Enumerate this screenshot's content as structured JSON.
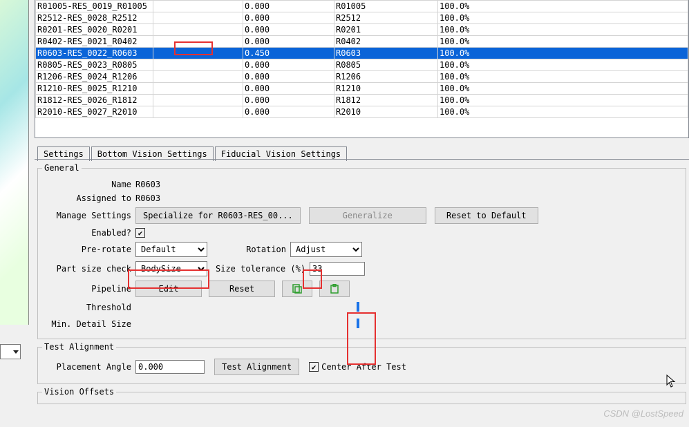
{
  "table": {
    "rows": [
      {
        "c1": "R01005-RES_0019_R01005",
        "c3": "0.000",
        "c4": "R01005",
        "c5": "100.0%"
      },
      {
        "c1": "R2512-RES_0028_R2512",
        "c3": "0.000",
        "c4": "R2512",
        "c5": "100.0%"
      },
      {
        "c1": "R0201-RES_0020_R0201",
        "c3": "0.000",
        "c4": "R0201",
        "c5": "100.0%"
      },
      {
        "c1": "R0402-RES_0021_R0402",
        "c3": "0.000",
        "c4": "R0402",
        "c5": "100.0%"
      },
      {
        "c1": "R0603-RES_0022_R0603",
        "c3": "0.450",
        "c4": "R0603",
        "c5": "100.0%",
        "sel": true
      },
      {
        "c1": "R0805-RES_0023_R0805",
        "c3": "0.000",
        "c4": "R0805",
        "c5": "100.0%"
      },
      {
        "c1": "R1206-RES_0024_R1206",
        "c3": "0.000",
        "c4": "R1206",
        "c5": "100.0%"
      },
      {
        "c1": "R1210-RES_0025_R1210",
        "c3": "0.000",
        "c4": "R1210",
        "c5": "100.0%"
      },
      {
        "c1": "R1812-RES_0026_R1812",
        "c3": "0.000",
        "c4": "R1812",
        "c5": "100.0%"
      },
      {
        "c1": "R2010-RES_0027_R2010",
        "c3": "0.000",
        "c4": "R2010",
        "c5": "100.0%"
      }
    ]
  },
  "tabs": {
    "settings": "Settings",
    "bottom": "Bottom Vision Settings",
    "fiducial": "Fiducial Vision Settings"
  },
  "general": {
    "legend": "General",
    "name_label": "Name",
    "name_value": "R0603",
    "assigned_label": "Assigned to",
    "assigned_value": "R0603",
    "manage_label": "Manage Settings",
    "specialize_btn": "Specialize for  R0603-RES_00...",
    "generalize_btn": "Generalize",
    "reset_default_btn": "Reset to Default",
    "enabled_label": "Enabled?",
    "prerotate_label": "Pre-rotate",
    "prerotate_value": "Default",
    "rotation_label": "Rotation",
    "rotation_value": "Adjust",
    "partsize_label": "Part size check",
    "partsize_value": "BodySize",
    "sizetol_label": "Size tolerance (%)",
    "sizetol_value": "33",
    "pipeline_label": "Pipeline",
    "edit_btn": "Edit",
    "reset_btn": "Reset",
    "threshold_label": "Threshold",
    "mindetail_label": "Min. Detail Size"
  },
  "test": {
    "legend": "Test Alignment",
    "angle_label": "Placement Angle",
    "angle_value": "0.000",
    "test_btn": "Test Alignment",
    "center_label": "Center After Test"
  },
  "offsets": {
    "legend": "Vision Offsets"
  },
  "icons": {
    "copy": "copy-icon",
    "paste": "paste-icon"
  },
  "watermark": "CSDN @LostSpeed"
}
